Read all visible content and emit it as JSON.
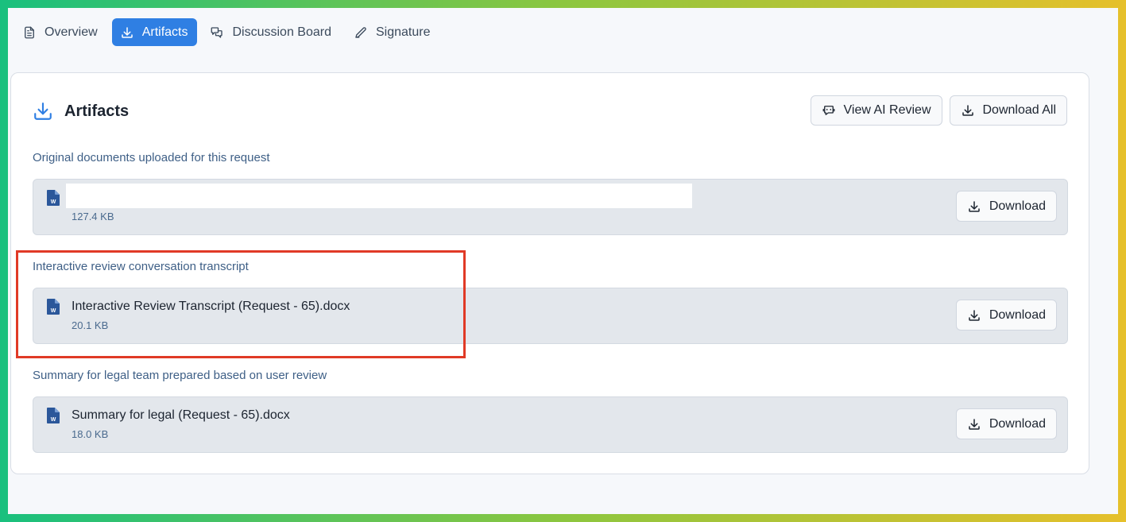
{
  "tabs": [
    {
      "label": "Overview",
      "icon": "document-icon",
      "active": false
    },
    {
      "label": "Artifacts",
      "icon": "download-icon",
      "active": true
    },
    {
      "label": "Discussion Board",
      "icon": "chat-bubbles-icon",
      "active": false
    },
    {
      "label": "Signature",
      "icon": "pen-icon",
      "active": false
    }
  ],
  "card": {
    "title": "Artifacts",
    "title_icon": "download-icon",
    "view_ai_review_label": "View AI Review",
    "download_all_label": "Download All"
  },
  "sections": [
    {
      "label": "Original documents uploaded for this request",
      "file": {
        "name": "",
        "size": "127.4 KB",
        "icon": "word-file-icon",
        "download_label": "Download",
        "name_redacted": true
      }
    },
    {
      "label": "Interactive review conversation transcript",
      "file": {
        "name": "Interactive Review Transcript (Request - 65).docx",
        "size": "20.1 KB",
        "icon": "word-file-icon",
        "download_label": "Download"
      }
    },
    {
      "label": "Summary for legal team prepared based on user review",
      "file": {
        "name": "Summary for legal (Request - 65).docx",
        "size": "18.0 KB",
        "icon": "word-file-icon",
        "download_label": "Download"
      }
    }
  ],
  "colors": {
    "accent": "#2f7fe3",
    "highlight": "#e03a26",
    "word_icon": "#2b579a",
    "label": "#3e5f86"
  }
}
